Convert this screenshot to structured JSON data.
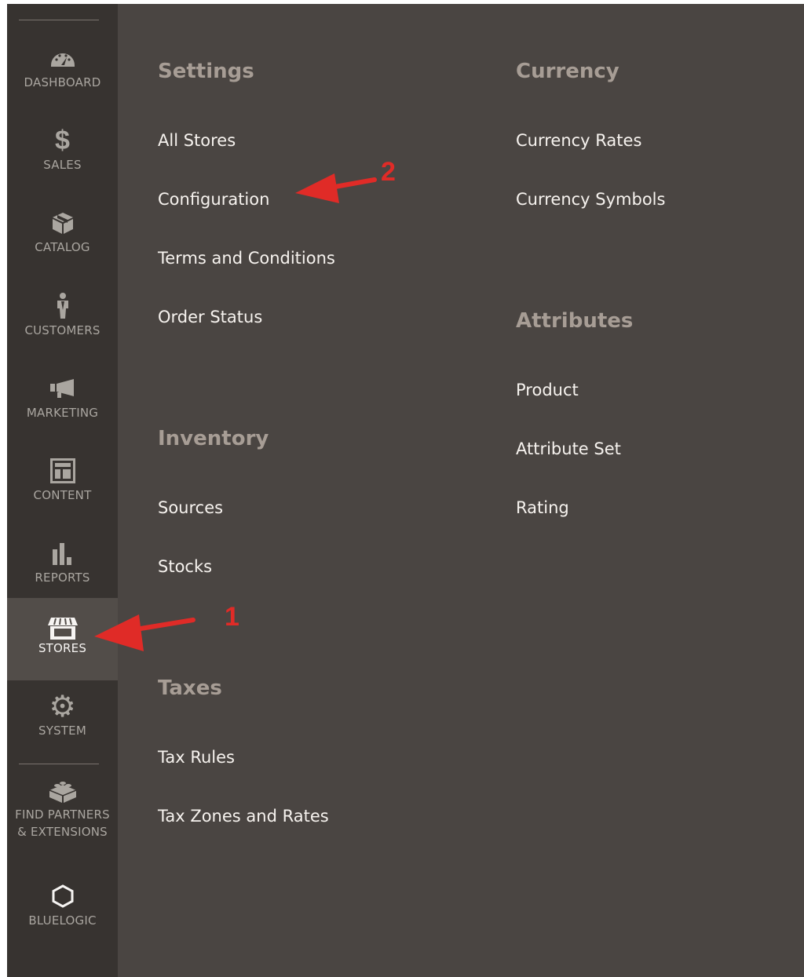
{
  "sidebar": {
    "items": [
      {
        "id": "dashboard",
        "label": "DASHBOARD",
        "icon": "speedometer-icon"
      },
      {
        "id": "sales",
        "label": "SALES",
        "icon": "dollar-icon"
      },
      {
        "id": "catalog",
        "label": "CATALOG",
        "icon": "box-icon"
      },
      {
        "id": "customers",
        "label": "CUSTOMERS",
        "icon": "person-icon"
      },
      {
        "id": "marketing",
        "label": "MARKETING",
        "icon": "megaphone-icon"
      },
      {
        "id": "content",
        "label": "CONTENT",
        "icon": "layout-icon"
      },
      {
        "id": "reports",
        "label": "REPORTS",
        "icon": "bar-chart-icon"
      },
      {
        "id": "stores",
        "label": "STORES",
        "icon": "storefront-icon",
        "active": true
      },
      {
        "id": "system",
        "label": "SYSTEM",
        "icon": "gear-icon"
      },
      {
        "id": "partners",
        "label": "FIND PARTNERS\n& EXTENSIONS",
        "icon": "lego-brick-icon"
      },
      {
        "id": "bluelogic",
        "label": "BLUELOGIC",
        "icon": "hexagon-icon"
      }
    ]
  },
  "menu": {
    "settings": {
      "title": "Settings",
      "links": [
        "All Stores",
        "Configuration",
        "Terms and Conditions",
        "Order Status"
      ]
    },
    "inventory": {
      "title": "Inventory",
      "links": [
        "Sources",
        "Stocks"
      ]
    },
    "taxes": {
      "title": "Taxes",
      "links": [
        "Tax Rules",
        "Tax Zones and Rates"
      ]
    },
    "currency": {
      "title": "Currency",
      "links": [
        "Currency Rates",
        "Currency Symbols"
      ]
    },
    "attributes": {
      "title": "Attributes",
      "links": [
        "Product",
        "Attribute Set",
        "Rating"
      ]
    }
  },
  "annotations": {
    "one": "1",
    "two": "2"
  },
  "colors": {
    "annotation": "#e02b27",
    "sidebar": "#373330",
    "panel": "#4a4542",
    "active": "#524d49"
  }
}
